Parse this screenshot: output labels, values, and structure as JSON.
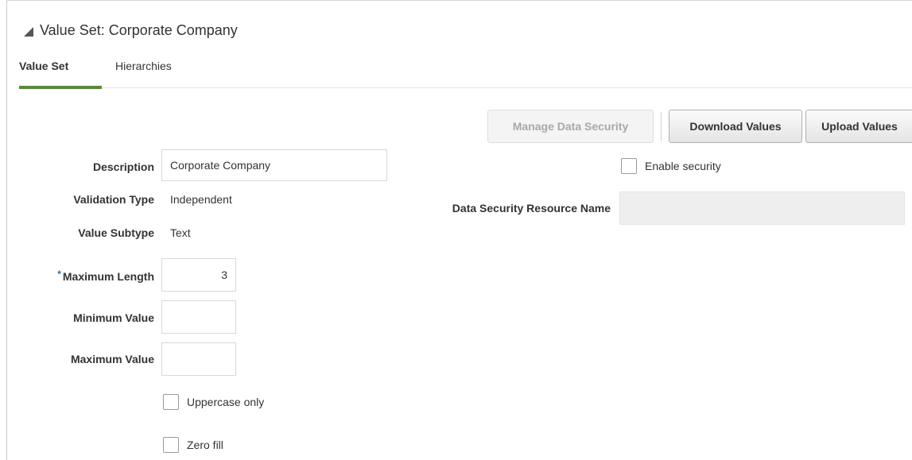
{
  "panel": {
    "title": "Value Set: Corporate Company"
  },
  "tabs": {
    "value_set": "Value Set",
    "hierarchies": "Hierarchies"
  },
  "toolbar": {
    "manage_security": "Manage Data Security",
    "download": "Download Values",
    "upload": "Upload Values"
  },
  "form": {
    "description_label": "Description",
    "description_value": "Corporate Company",
    "validation_type_label": "Validation Type",
    "validation_type_value": "Independent",
    "value_subtype_label": "Value Subtype",
    "value_subtype_value": "Text",
    "required_marker": "*",
    "max_length_label": "Maximum Length",
    "max_length_value": "3",
    "min_value_label": "Minimum Value",
    "min_value_value": "",
    "max_value_label": "Maximum Value",
    "max_value_value": "",
    "uppercase_label": "Uppercase only",
    "zero_fill_label": "Zero fill"
  },
  "security": {
    "enable_label": "Enable security",
    "resource_name_label": "Data Security Resource Name",
    "resource_name_value": ""
  }
}
